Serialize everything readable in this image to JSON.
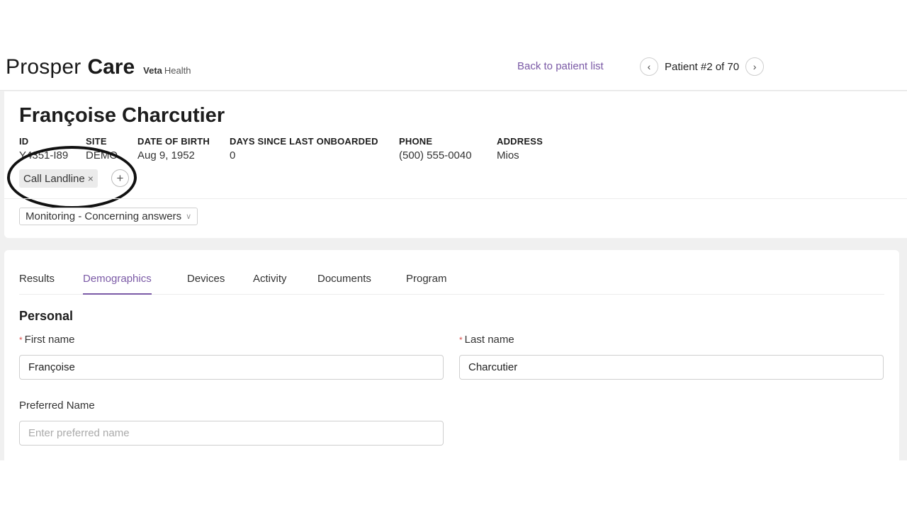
{
  "brand": {
    "prosper": "Prosper",
    "care": "Care",
    "veta": "Veta",
    "health": "Health"
  },
  "nav": {
    "back_link": "Back to patient list",
    "prev_icon": "‹",
    "next_icon": "›",
    "pager_text": "Patient #2 of 70"
  },
  "patient": {
    "name": "Françoise Charcutier",
    "info": [
      {
        "label": "ID",
        "value": "Y4351-I89"
      },
      {
        "label": "SITE",
        "value": "DEMO"
      },
      {
        "label": "DATE OF BIRTH",
        "value": "Aug 9, 1952"
      },
      {
        "label": "DAYS SINCE LAST ONBOARDED",
        "value": "0"
      },
      {
        "label": "PHONE",
        "value": "(500) 555-0040"
      },
      {
        "label": "ADDRESS",
        "value": "Mios"
      }
    ],
    "tag": "Call Landline",
    "tag_close": "×",
    "add_tag": "+",
    "status": "Monitoring - Concerning answers",
    "status_caret": "∨"
  },
  "tabs": [
    "Results",
    "Demographics",
    "Devices",
    "Activity",
    "Documents",
    "Program"
  ],
  "active_tab": "Demographics",
  "form": {
    "section_title": "Personal",
    "required_marker": "*",
    "first_name_label": "First name",
    "first_name_value": "Françoise",
    "last_name_label": "Last name",
    "last_name_value": "Charcutier",
    "preferred_name_label": "Preferred Name",
    "preferred_name_placeholder": "Enter preferred name"
  }
}
